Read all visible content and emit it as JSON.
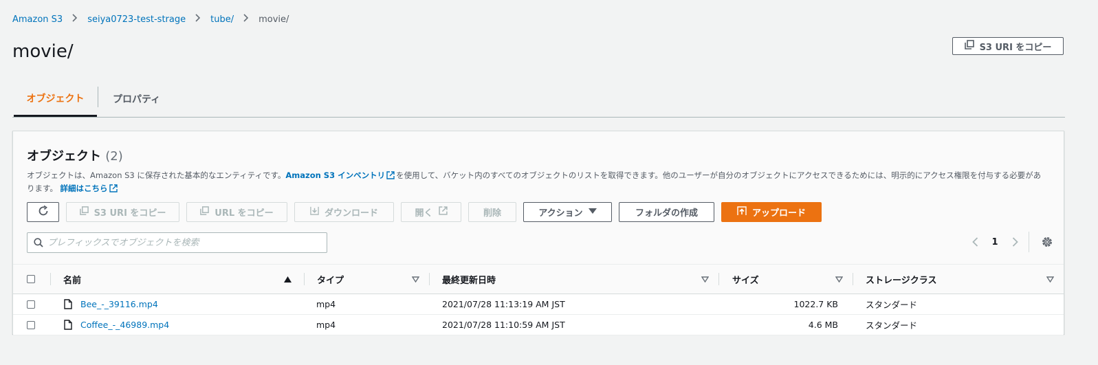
{
  "breadcrumb": {
    "items": [
      "Amazon S3",
      "seiya0723-test-strage",
      "tube/"
    ],
    "current": "movie/"
  },
  "page": {
    "title": "movie/",
    "copy_uri_label": "S3 URI をコピー"
  },
  "tabs": {
    "objects": "オブジェクト",
    "properties": "プロパティ"
  },
  "panel": {
    "title": "オブジェクト",
    "count": "(2)",
    "desc_part1": "オブジェクトは、Amazon S3 に保存された基本的なエンティティです。",
    "desc_link": "Amazon S3 インベントリ",
    "desc_part2": "を使用して、バケット内のすべてのオブジェクトのリストを取得できます。他のユーザーが自分のオブジェクトにアクセスできるためには、明示的にアクセス権限を付与する必要があります。",
    "learn_more": "詳細はこちら"
  },
  "toolbar": {
    "copy_s3_uri": "S3 URI をコピー",
    "copy_url": "URL をコピー",
    "download": "ダウンロード",
    "open": "開く",
    "delete": "削除",
    "actions": "アクション",
    "create_folder": "フォルダの作成",
    "upload": "アップロード"
  },
  "search": {
    "placeholder": "プレフィックスでオブジェクトを検索"
  },
  "pagination": {
    "current_page": "1"
  },
  "table": {
    "columns": {
      "name": "名前",
      "type": "タイプ",
      "modified": "最終更新日時",
      "size": "サイズ",
      "storage_class": "ストレージクラス"
    },
    "rows": [
      {
        "name": "Bee_-_39116.mp4",
        "type": "mp4",
        "modified": "2021/07/28 11:13:19 AM JST",
        "size": "1022.7 KB",
        "storage_class": "スタンダード"
      },
      {
        "name": "Coffee_-_46989.mp4",
        "type": "mp4",
        "modified": "2021/07/28 11:10:59 AM JST",
        "size": "4.6 MB",
        "storage_class": "スタンダード"
      }
    ]
  },
  "colors": {
    "accent_orange": "#ec7211",
    "link_blue": "#0073bb",
    "text_dark": "#16191f",
    "background": "#f2f3f3"
  }
}
